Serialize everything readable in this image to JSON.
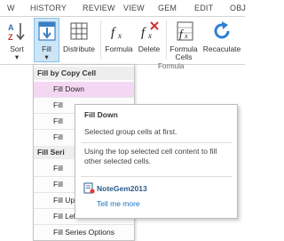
{
  "ribbon_tabs": [
    "W",
    "HISTORY",
    "REVIEW",
    "VIEW",
    "GEM",
    "EDIT",
    "OBJ"
  ],
  "ribbon": {
    "buttons": {
      "sort": "Sort",
      "fill": "Fill",
      "distribute": "Distribute",
      "formula": "Formula",
      "delete": "Delete",
      "formula_cells_line1": "Formula",
      "formula_cells_line2": "Cells",
      "recaculate": "Recaculate"
    },
    "group_label": "Formula"
  },
  "fill_menu": {
    "section1_header": "Fill by Copy Cell",
    "section2_header": "Fill Seri",
    "items": [
      "Fill Down",
      "Fill",
      "Fill",
      "Fill",
      "Fill Up",
      "Fill Left",
      "Fill Series Options"
    ],
    "hidden_items": [
      "Fill",
      "Fill"
    ],
    "selected_item": "Fill Down"
  },
  "tooltip": {
    "title": "Fill Down",
    "line1": "Selected group cells at first.",
    "line2": "Using the top selected cell content to fill other selected cells.",
    "brand": "NoteGem2013",
    "help_link": "Tell me more"
  },
  "colors": {
    "selected_menu_item": "#f4d7f2",
    "fill_button_bg": "#cde6f7",
    "link": "#1a73c2"
  }
}
